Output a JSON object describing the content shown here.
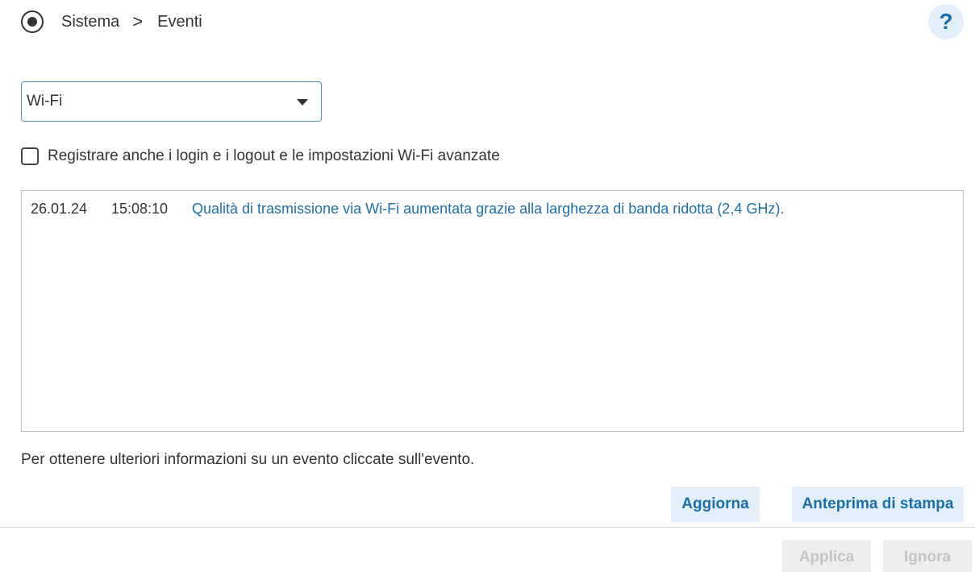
{
  "breadcrumb": {
    "icon": "radio-target-icon",
    "section": "Sistema",
    "separator": ">",
    "page": "Eventi"
  },
  "help": {
    "label": "?"
  },
  "filter": {
    "selected": "Wi-Fi"
  },
  "checkbox": {
    "label": "Registrare anche i login e i logout e le impostazioni Wi-Fi avanzate",
    "checked": false
  },
  "events": [
    {
      "date": "26.01.24",
      "time": "15:08:10",
      "message": "Qualità di trasmissione via Wi-Fi aumentata grazie alla larghezza di banda ridotta (2,4 GHz)."
    }
  ],
  "hint": "Per ottenere ulteriori informazioni su un evento cliccate sull'evento.",
  "buttons": {
    "refresh": "Aggiorna",
    "print_preview": "Anteprima di stampa",
    "apply": "Applica",
    "ignore": "Ignora"
  },
  "colors": {
    "accent": "#1d6fa8",
    "button_bg": "#e2eef8",
    "disabled_bg": "#eeeeee",
    "disabled_text": "#c4c4c4"
  }
}
